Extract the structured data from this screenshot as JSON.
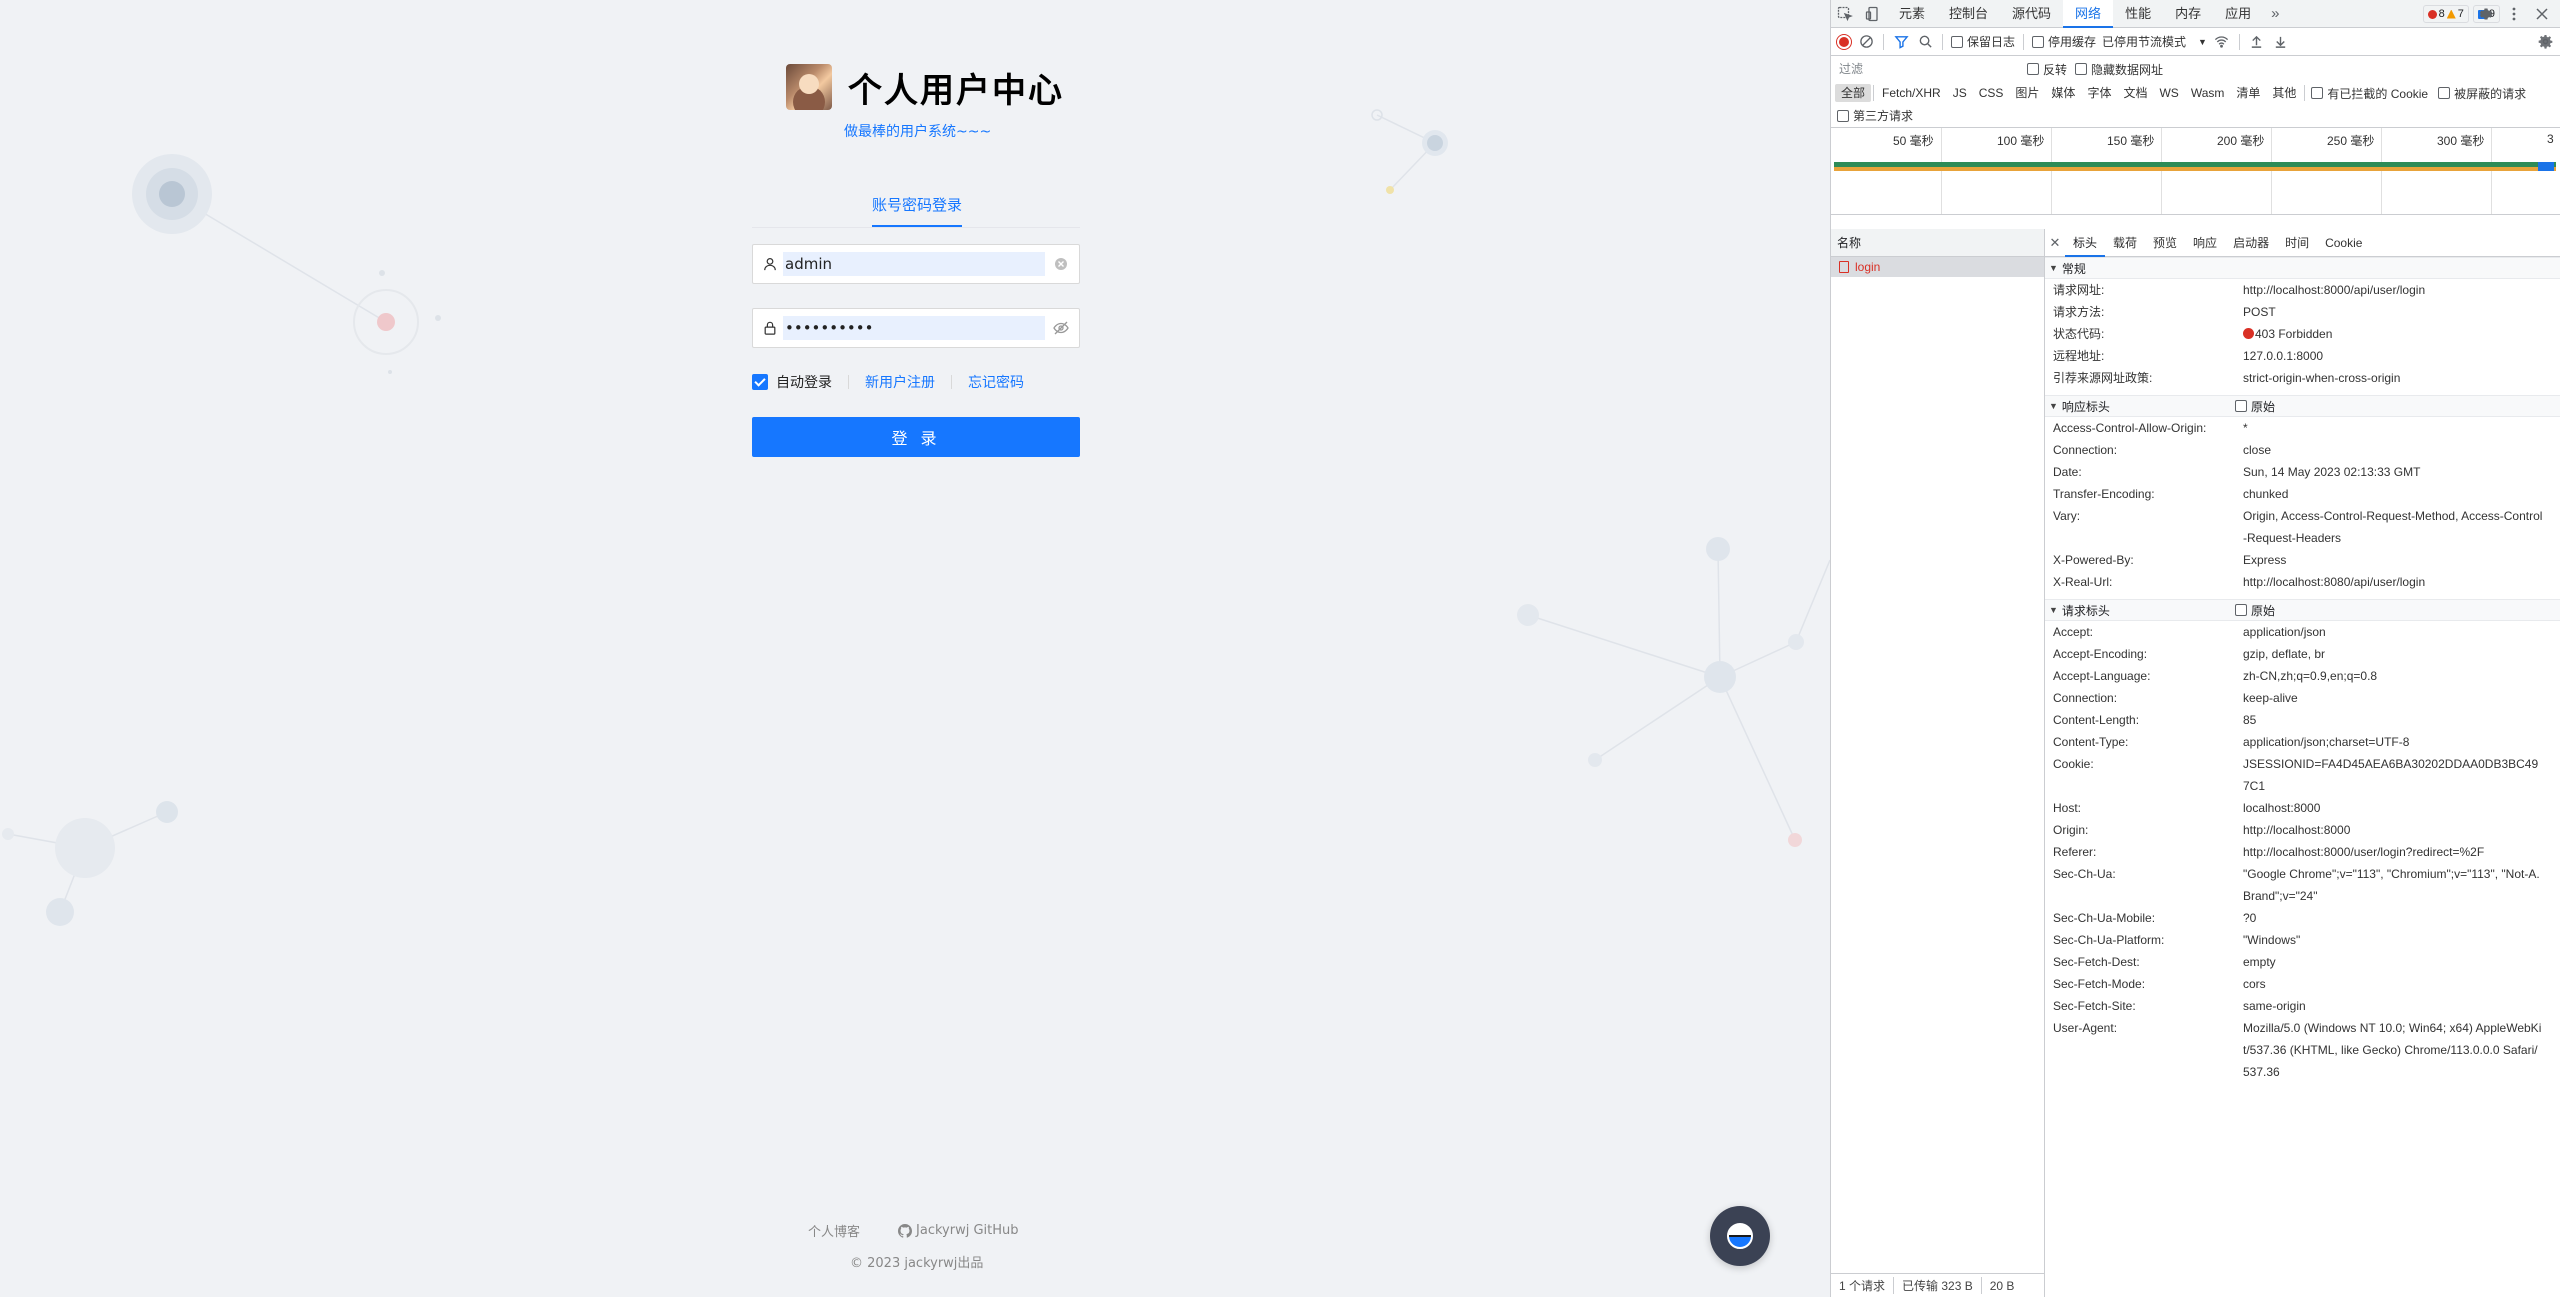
{
  "login": {
    "title": "个人用户中心",
    "subtitle": "做最棒的用户系统~~~",
    "tab_label": "账号密码登录",
    "username_value": "admin",
    "password_value": "••••••••••",
    "auto_login_label": "自动登录",
    "register_link": "新用户注册",
    "forgot_link": "忘记密码",
    "submit_label": "登 录",
    "footer_blog": "个人博客",
    "footer_github": "Jackyrwj GitHub",
    "copyright": "© 2023 jackyrwj出品"
  },
  "devtools": {
    "tabs": [
      "元素",
      "控制台",
      "源代码",
      "网络",
      "性能",
      "内存",
      "应用"
    ],
    "active_tab": "网络",
    "more": "»",
    "badge_errors": "8",
    "badge_warnings": "7",
    "badge_messages": "9",
    "toolbar": {
      "preserve_log": "保留日志",
      "disable_cache": "停用缓存",
      "throttle": "已停用节流模式",
      "throttle_caret": "▼"
    },
    "filter_placeholder": "过滤",
    "invert": "反转",
    "hide_data_urls": "隐藏数据网址",
    "types": [
      "全部",
      "Fetch/XHR",
      "JS",
      "CSS",
      "图片",
      "媒体",
      "字体",
      "文档",
      "WS",
      "Wasm",
      "清单",
      "其他"
    ],
    "blocked_cookies": "有已拦截的 Cookie",
    "blocked_requests": "被屏蔽的请求",
    "third_party": "第三方请求",
    "timeline_ticks": [
      "50 毫秒",
      "100 毫秒",
      "150 毫秒",
      "200 毫秒",
      "250 毫秒",
      "300 毫秒",
      "3"
    ],
    "name_header": "名称",
    "request_name": "login",
    "status_count": "1 个请求",
    "status_transferred": "已传输 323 B",
    "status_size": "20 B",
    "detail_close": "✕",
    "detail_tabs": [
      "标头",
      "载荷",
      "预览",
      "响应",
      "启动器",
      "时间",
      "Cookie"
    ],
    "raw_label": "原始",
    "general": {
      "title": "常规",
      "rows": [
        {
          "k": "请求网址:",
          "v": "http://localhost:8000/api/user/login"
        },
        {
          "k": "请求方法:",
          "v": "POST"
        },
        {
          "k": "状态代码:",
          "v": "403 Forbidden"
        },
        {
          "k": "远程地址:",
          "v": "127.0.0.1:8000"
        },
        {
          "k": "引荐来源网址政策:",
          "v": "strict-origin-when-cross-origin"
        }
      ]
    },
    "response_headers": {
      "title": "响应标头",
      "rows": [
        {
          "k": "Access-Control-Allow-Origin:",
          "v": "*"
        },
        {
          "k": "Connection:",
          "v": "close"
        },
        {
          "k": "Date:",
          "v": "Sun, 14 May 2023 02:13:33 GMT"
        },
        {
          "k": "Transfer-Encoding:",
          "v": "chunked"
        },
        {
          "k": "Vary:",
          "v": "Origin, Access-Control-Request-Method, Access-Control-Request-Headers"
        },
        {
          "k": "X-Powered-By:",
          "v": "Express"
        },
        {
          "k": "X-Real-Url:",
          "v": "http://localhost:8080/api/user/login"
        }
      ]
    },
    "request_headers": {
      "title": "请求标头",
      "rows": [
        {
          "k": "Accept:",
          "v": "application/json"
        },
        {
          "k": "Accept-Encoding:",
          "v": "gzip, deflate, br"
        },
        {
          "k": "Accept-Language:",
          "v": "zh-CN,zh;q=0.9,en;q=0.8"
        },
        {
          "k": "Connection:",
          "v": "keep-alive"
        },
        {
          "k": "Content-Length:",
          "v": "85"
        },
        {
          "k": "Content-Type:",
          "v": "application/json;charset=UTF-8"
        },
        {
          "k": "Cookie:",
          "v": "JSESSIONID=FA4D45AEA6BA30202DDAA0DB3BC497C1"
        },
        {
          "k": "Host:",
          "v": "localhost:8000"
        },
        {
          "k": "Origin:",
          "v": "http://localhost:8000"
        },
        {
          "k": "Referer:",
          "v": "http://localhost:8000/user/login?redirect=%2F"
        },
        {
          "k": "Sec-Ch-Ua:",
          "v": "\"Google Chrome\";v=\"113\", \"Chromium\";v=\"113\", \"Not-A.Brand\";v=\"24\""
        },
        {
          "k": "Sec-Ch-Ua-Mobile:",
          "v": "?0"
        },
        {
          "k": "Sec-Ch-Ua-Platform:",
          "v": "\"Windows\""
        },
        {
          "k": "Sec-Fetch-Dest:",
          "v": "empty"
        },
        {
          "k": "Sec-Fetch-Mode:",
          "v": "cors"
        },
        {
          "k": "Sec-Fetch-Site:",
          "v": "same-origin"
        },
        {
          "k": "User-Agent:",
          "v": "Mozilla/5.0 (Windows NT 10.0; Win64; x64) AppleWebKit/537.36 (KHTML, like Gecko) Chrome/113.0.0.0 Safari/537.36"
        }
      ]
    }
  },
  "colors": {
    "brand": "#1677ff",
    "error": "#d93025",
    "devtools_accent": "#1a73e8"
  }
}
